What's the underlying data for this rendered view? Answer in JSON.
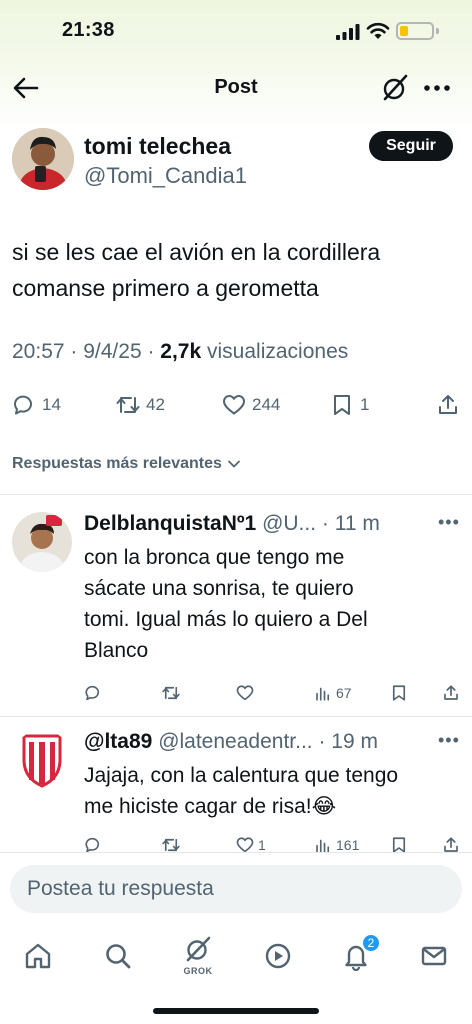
{
  "status_bar": {
    "time": "21:38",
    "battery_level": 0.25,
    "battery_color": "#f5c400"
  },
  "header": {
    "title": "Post",
    "back_icon": "arrow-left-icon",
    "grok_icon": "grok-icon",
    "more_icon": "more-horizontal-icon"
  },
  "tweet": {
    "author_name": "tomi telechea",
    "author_handle": "@Tomi_Candia1",
    "follow_label": "Seguir",
    "text_lines": [
      "si se les cae el avión en la cordillera",
      "comanse primero a gerometta"
    ],
    "time": "20:57",
    "date": "9/4/25",
    "views_count": "2,7k",
    "views_label": "visualizaciones",
    "actions": {
      "replies": "14",
      "retweets": "42",
      "likes": "244",
      "bookmarks": "1"
    }
  },
  "replies_sort_label": "Respuestas más relevantes",
  "replies": [
    {
      "name": "DelblanquistaNº1",
      "handle": "@U...",
      "time": "11 m",
      "text_lines": [
        "con la bronca que tengo me",
        "sácate una sonrisa, te quiero",
        "tomi. Igual más lo quiero a Del",
        "Blanco"
      ],
      "views": "67"
    },
    {
      "name": "@lta89",
      "handle": "@lateneadentr...",
      "time": "19 m",
      "text_lines": [
        "Jajaja, con la calentura que tengo",
        "me hiciste cagar de risa!😂"
      ],
      "likes": "1",
      "views": "161"
    }
  ],
  "composer": {
    "placeholder": "Postea tu respuesta"
  },
  "tabbar": {
    "grok_label": "GROK",
    "notifications_badge": "2"
  },
  "colors": {
    "accent": "#1d9bf0",
    "text": "#0f1419",
    "muted": "#536471"
  }
}
